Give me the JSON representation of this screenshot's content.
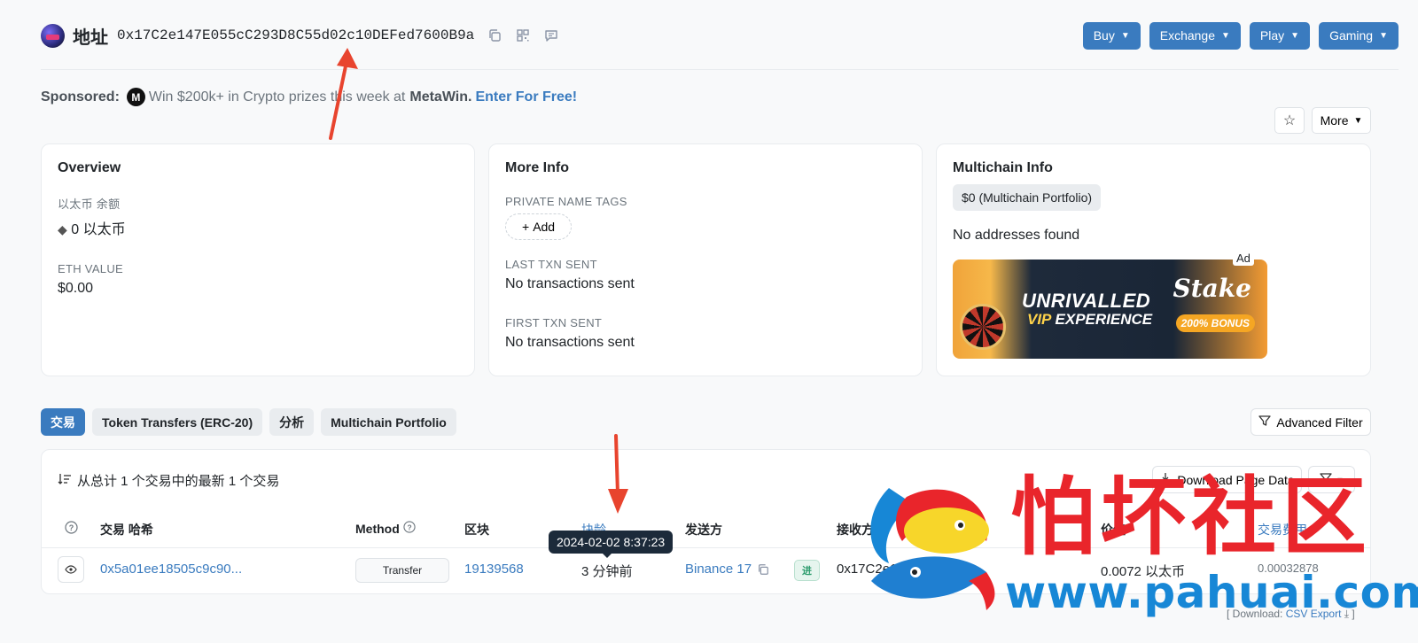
{
  "header": {
    "title": "地址",
    "address": "0x17C2e147E055cC293D8C55d02c10DEFed7600B9a",
    "menus": [
      {
        "label": "Buy"
      },
      {
        "label": "Exchange"
      },
      {
        "label": "Play"
      },
      {
        "label": "Gaming"
      }
    ],
    "icons": [
      "copy-icon",
      "qr-code-icon",
      "comment-icon"
    ]
  },
  "sponsor": {
    "label": "Sponsored:",
    "logo_letter": "M",
    "text": "Win $200k+ in Crypto prizes this week at",
    "brand": "MetaWin.",
    "cta": "Enter For Free!"
  },
  "actions": {
    "more_label": "More"
  },
  "overview": {
    "title": "Overview",
    "balance_label": "以太币 余额",
    "balance_value": "0 以太币",
    "value_label": "ETH VALUE",
    "value_value": "$0.00"
  },
  "more_info": {
    "title": "More Info",
    "tags_label": "PRIVATE NAME TAGS",
    "add_label": "Add",
    "last_label": "LAST TXN SENT",
    "last_value": "No transactions sent",
    "first_label": "FIRST TXN SENT",
    "first_value": "No transactions sent"
  },
  "multichain": {
    "title": "Multichain Info",
    "portfolio_label": "$0 (Multichain Portfolio)",
    "empty_text": "No addresses found",
    "ad": {
      "tag": "Ad",
      "line1": "UNRIVALLED",
      "line2a": "VIP",
      "line2b": "EXPERIENCE",
      "brand": "Stake",
      "bonus": "200% BONUS"
    }
  },
  "tabs": [
    {
      "label": "交易",
      "active": true
    },
    {
      "label": "Token Transfers (ERC-20)",
      "active": false
    },
    {
      "label": "分析",
      "active": false
    },
    {
      "label": "Multichain Portfolio",
      "active": false
    }
  ],
  "advanced_filter_label": "Advanced Filter",
  "transactions": {
    "summary": "从总计 1 个交易中的最新 1 个交易",
    "download_label": "Download Page Data",
    "columns": {
      "hash": "交易 哈希",
      "method": "Method",
      "block": "区块",
      "age": "块龄",
      "from": "发送方",
      "to": "接收方",
      "value": "价值",
      "fee": "交易费用"
    },
    "tooltip": "2024-02-02 8:37:23",
    "row": {
      "hash": "0x5a01ee18505c9c90...",
      "method": "Transfer",
      "block": "19139568",
      "age": "3 分钟前",
      "from": "Binance 17",
      "direction": "进",
      "to": "0x17C2e1...0B9a",
      "value": "0.0072 以太币",
      "fee": "0.00032878"
    },
    "csv_prefix": "[ Download:",
    "csv_link": "CSV Export",
    "csv_suffix": "]"
  },
  "watermark": {
    "text": "怕坏社区",
    "url": "www.pahuai.com"
  },
  "colors": {
    "accent": "#3a7bbf",
    "arrow": "#e8442e",
    "watermark_red": "#e9252b",
    "watermark_blue": "#1787d6"
  }
}
